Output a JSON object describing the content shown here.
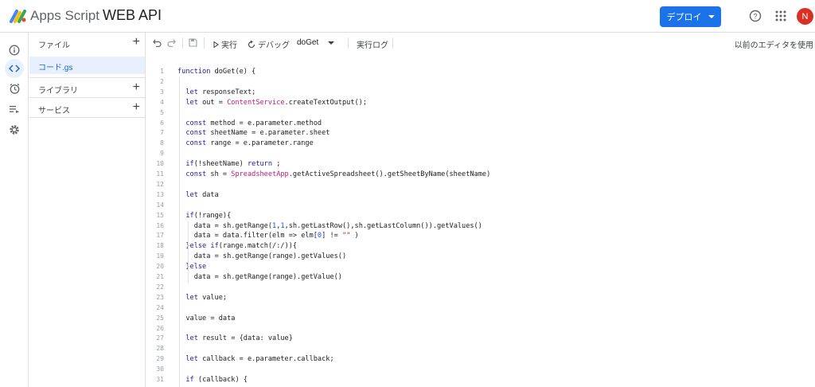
{
  "header": {
    "app_name": "Apps Script",
    "project_title": "WEB API",
    "deploy_label": "デプロイ",
    "avatar_initial": "N",
    "brand_color": "#1a73e8"
  },
  "rail": {
    "items": [
      {
        "icon": "info-icon"
      },
      {
        "icon": "code-icon",
        "active": true
      },
      {
        "icon": "clock-icon"
      },
      {
        "icon": "executions-icon"
      },
      {
        "icon": "settings-icon"
      }
    ]
  },
  "sidebar": {
    "files_label": "ファイル",
    "file_name": "コード.gs",
    "libraries_label": "ライブラリ",
    "services_label": "サービス"
  },
  "toolbar": {
    "run_label": "実行",
    "debug_label": "デバッグ",
    "function_name": "doGet",
    "log_label": "実行ログ",
    "legacy_label": "以前のエディタを使用"
  },
  "code_lines": [
    "function doGet(e) {",
    "",
    "  let responseText;",
    "  let out = ContentService.createTextOutput();",
    "",
    "  const method = e.parameter.method",
    "  const sheetName = e.parameter.sheet",
    "  const range = e.parameter.range",
    "",
    "  if(!sheetName) return ;",
    "  const sh = SpreadsheetApp.getActiveSpreadsheet().getSheetByName(sheetName)",
    "",
    "  let data",
    "",
    "  if(!range){",
    "    data = sh.getRange(1,1,sh.getLastRow(),sh.getLastColumn()).getValues()",
    "    data = data.filter(elm => elm[0] != \"\" )",
    "  }else if(range.match(/:/)){",
    "    data = sh.getRange(range).getValues()",
    "  }else",
    "    data = sh.getRange(range).getValue()",
    "",
    "  let value;",
    "",
    "  value = data",
    "",
    "  let result = {data: value}",
    "",
    "  let callback = e.parameter.callback;",
    "",
    "  if (callback) {"
  ]
}
